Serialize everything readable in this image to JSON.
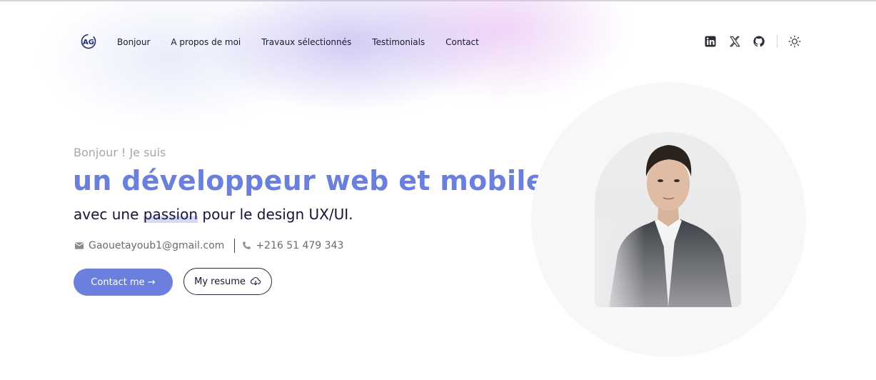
{
  "nav": {
    "logo_text": "AG",
    "links": [
      "Bonjour",
      "A propos de moi",
      "Travaux sélectionnés",
      "Testimonials",
      "Contact"
    ],
    "social_icons": [
      "linkedin-icon",
      "x-icon",
      "github-icon"
    ],
    "theme_icon": "sun-icon"
  },
  "hero": {
    "greeting": "Bonjour ! Je suis",
    "headline": "un développeur web et mobile",
    "subline_before": "avec une ",
    "subline_highlight": "passion",
    "subline_after": " pour le design UX/UI.",
    "email": "Gaouetayoub1@gmail.com",
    "phone": "+216 51 479 343",
    "contact_button": "Contact me →",
    "resume_button": "My resume"
  },
  "colors": {
    "accent": "#6b80dc",
    "text_dark": "#161634",
    "muted": "#a5a5ad"
  }
}
